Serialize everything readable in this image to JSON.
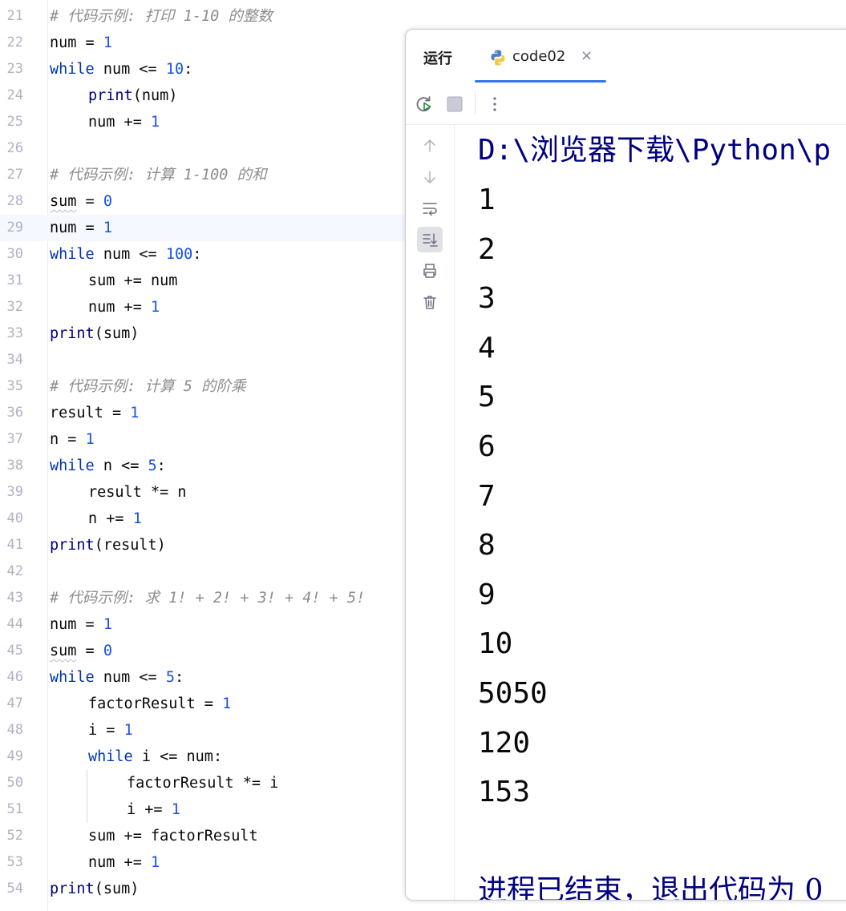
{
  "editor": {
    "lines": [
      {
        "n": "21",
        "text": "# 代码示例: 打印 1-10 的整数"
      },
      {
        "n": "22",
        "text": "num = 1"
      },
      {
        "n": "23",
        "text": "while num <= 10:"
      },
      {
        "n": "24",
        "text": "print(num)"
      },
      {
        "n": "25",
        "text": "num += 1"
      },
      {
        "n": "26",
        "text": ""
      },
      {
        "n": "27",
        "text": "# 代码示例: 计算 1-100 的和"
      },
      {
        "n": "28",
        "text": "sum = 0"
      },
      {
        "n": "29",
        "text": "num = 1"
      },
      {
        "n": "30",
        "text": "while num <= 100:"
      },
      {
        "n": "31",
        "text": "sum += num"
      },
      {
        "n": "32",
        "text": "num += 1"
      },
      {
        "n": "33",
        "text": "print(sum)"
      },
      {
        "n": "34",
        "text": ""
      },
      {
        "n": "35",
        "text": "# 代码示例: 计算 5 的阶乘"
      },
      {
        "n": "36",
        "text": "result = 1"
      },
      {
        "n": "37",
        "text": "n = 1"
      },
      {
        "n": "38",
        "text": "while n <= 5:"
      },
      {
        "n": "39",
        "text": "result *= n"
      },
      {
        "n": "40",
        "text": "n += 1"
      },
      {
        "n": "41",
        "text": "print(result)"
      },
      {
        "n": "42",
        "text": ""
      },
      {
        "n": "43",
        "text": "# 代码示例: 求 1! + 2! + 3! + 4! + 5!"
      },
      {
        "n": "44",
        "text": "num = 1"
      },
      {
        "n": "45",
        "text": "sum = 0"
      },
      {
        "n": "46",
        "text": "while num <= 5:"
      },
      {
        "n": "47",
        "text": "factorResult = 1"
      },
      {
        "n": "48",
        "text": "i = 1"
      },
      {
        "n": "49",
        "text": "while i <= num:"
      },
      {
        "n": "50",
        "text": "factorResult *= i"
      },
      {
        "n": "51",
        "text": "i += 1"
      },
      {
        "n": "52",
        "text": "sum += factorResult"
      },
      {
        "n": "53",
        "text": "num += 1"
      },
      {
        "n": "54",
        "text": "print(sum)"
      }
    ],
    "current_line": "29"
  },
  "run_panel": {
    "label": "运行",
    "tab_label": "code02",
    "tab_close": "×",
    "console_path": "D:\\浏览器下载\\Python\\p",
    "output": [
      "1",
      "2",
      "3",
      "4",
      "5",
      "6",
      "7",
      "8",
      "9",
      "10",
      "5050",
      "120",
      "153"
    ],
    "exit_message": "进程已结束，退出代码为 0"
  },
  "colors": {
    "keyword": "#0033b3",
    "number": "#1750eb",
    "builtin": "#000080",
    "comment": "#8c8c8c",
    "accent": "#3574f0"
  },
  "icons": {
    "tab": "python-icon",
    "toolbar": [
      "rerun-icon",
      "stop-icon",
      "more-icon"
    ],
    "sidebar": [
      "arrow-up-icon",
      "arrow-down-icon",
      "soft-wrap-icon",
      "scroll-to-end-icon",
      "print-icon",
      "trash-icon"
    ]
  }
}
